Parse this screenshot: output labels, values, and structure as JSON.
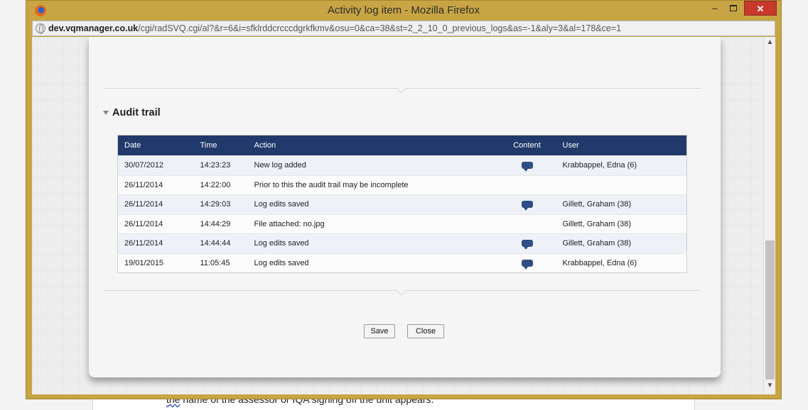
{
  "window": {
    "title": "Activity log item - Mozilla Firefox",
    "min_label": "–",
    "close_label": "✕"
  },
  "urlbar": {
    "host": "dev.vqmanager.co.uk",
    "path": "/cgi/radSVQ.cgi/al?&r=6&i=sfklrddcrcccdgrkfkmv&osu=0&ca=38&st=2_2_10_0_previous_logs&as=-1&aly=3&al=178&ce=1"
  },
  "background": {
    "text_word": "the",
    "text_rest": " name of the assessor or IQA signing off the unit appears."
  },
  "section": {
    "title": "Audit trail"
  },
  "table": {
    "headers": [
      "Date",
      "Time",
      "Action",
      "Content",
      "User"
    ],
    "rows": [
      {
        "date": "30/07/2012",
        "time": "14:23:23",
        "action": "New log added",
        "content": true,
        "user": "Krabbappel, Edna (6)"
      },
      {
        "date": "26/11/2014",
        "time": "14:22:00",
        "action": "Prior to this the audit trail may be incomplete",
        "content": false,
        "user": ""
      },
      {
        "date": "26/11/2014",
        "time": "14:29:03",
        "action": "Log edits saved",
        "content": true,
        "user": "Gillett, Graham (38)"
      },
      {
        "date": "26/11/2014",
        "time": "14:44:29",
        "action": "File attached: no.jpg",
        "content": false,
        "user": "Gillett, Graham (38)"
      },
      {
        "date": "26/11/2014",
        "time": "14:44:44",
        "action": "Log edits saved",
        "content": true,
        "user": "Gillett, Graham (38)"
      },
      {
        "date": "19/01/2015",
        "time": "11:05:45",
        "action": "Log edits saved",
        "content": true,
        "user": "Krabbappel, Edna (6)"
      }
    ]
  },
  "buttons": {
    "save": "Save",
    "close": "Close"
  },
  "icons": {
    "content_icon": "comment-icon"
  },
  "colors": {
    "table_header": "#22396b",
    "window_frame": "#c8a544",
    "close_button": "#c7392b"
  }
}
